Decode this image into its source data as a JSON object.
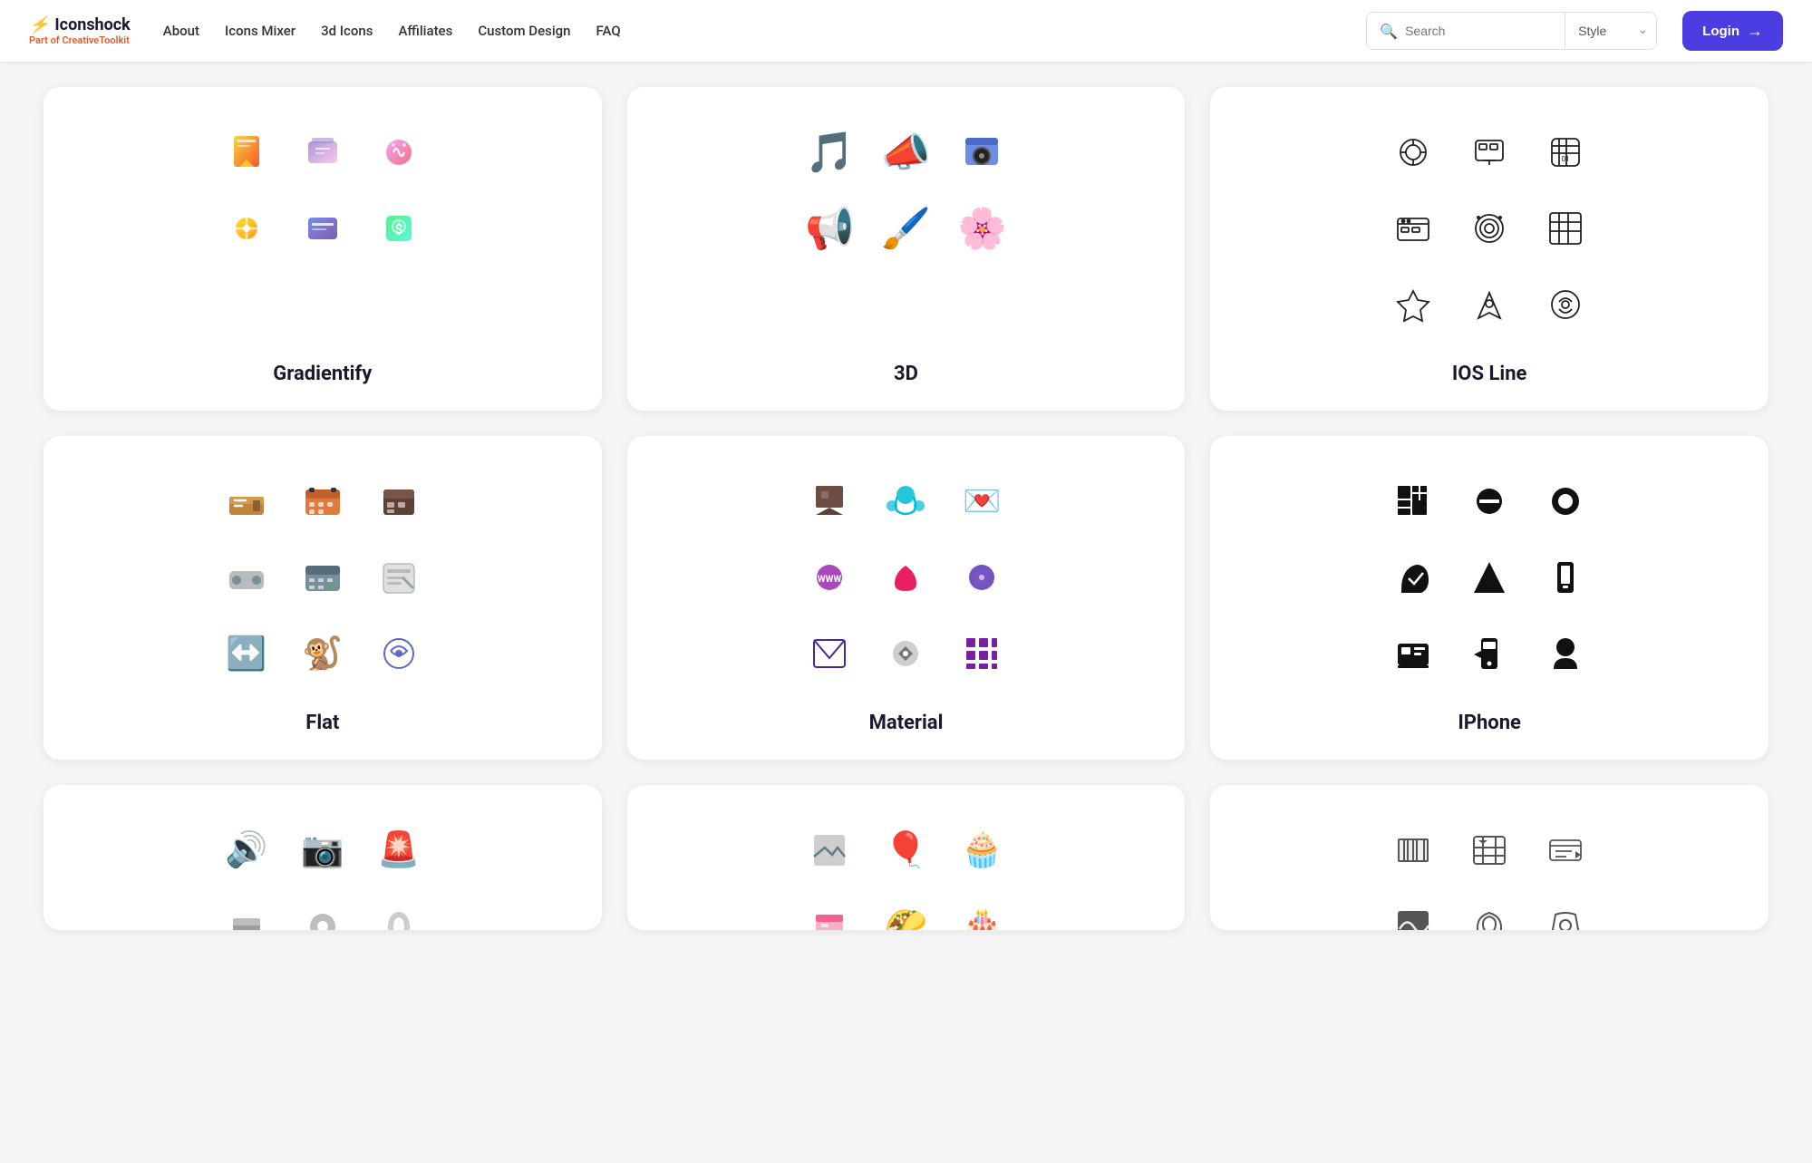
{
  "header": {
    "logo_name": "Iconshock",
    "logo_lightning": "⚡",
    "logo_sub_prefix": "Part of ",
    "logo_sub_brand": "CreativeToolkit",
    "nav": [
      {
        "label": "About",
        "id": "about"
      },
      {
        "label": "Icons Mixer",
        "id": "icons-mixer"
      },
      {
        "label": "3d Icons",
        "id": "3d-icons"
      },
      {
        "label": "Affiliates",
        "id": "affiliates"
      },
      {
        "label": "Custom Design",
        "id": "custom-design"
      },
      {
        "label": "FAQ",
        "id": "faq"
      }
    ],
    "search_placeholder": "Search",
    "style_label": "Style",
    "login_label": "Login"
  },
  "cards": [
    {
      "id": "gradientify",
      "title": "Gradientify",
      "style": "gradient"
    },
    {
      "id": "3d",
      "title": "3D",
      "style": "3d"
    },
    {
      "id": "ios-line",
      "title": "IOS Line",
      "style": "ios-line"
    },
    {
      "id": "flat",
      "title": "Flat",
      "style": "flat"
    },
    {
      "id": "material",
      "title": "Material",
      "style": "material"
    },
    {
      "id": "iphone",
      "title": "IPhone",
      "style": "iphone"
    },
    {
      "id": "bottom1",
      "title": "",
      "style": "bottom1",
      "partial": true
    },
    {
      "id": "bottom2",
      "title": "",
      "style": "bottom2",
      "partial": true
    },
    {
      "id": "bottom3",
      "title": "",
      "style": "bottom3",
      "partial": true
    }
  ]
}
